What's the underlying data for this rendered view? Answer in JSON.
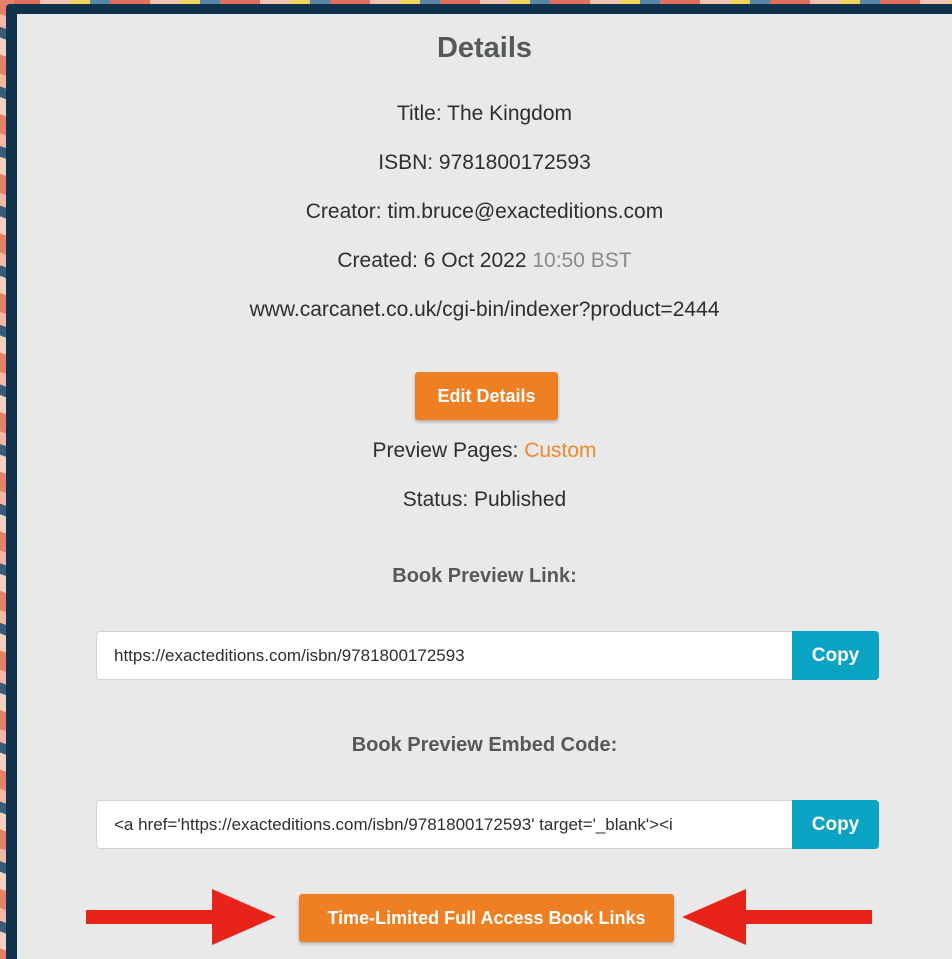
{
  "details": {
    "heading": "Details",
    "title": "Title: The Kingdom",
    "isbn": "ISBN: 9781800172593",
    "creator": "Creator: tim.bruce@exacteditions.com",
    "created_label": "Created: 6 Oct 2022",
    "created_time": "10:50 BST",
    "product_url": "www.carcanet.co.uk/cgi-bin/indexer?product=2444",
    "edit_button": "Edit Details",
    "preview_pages_label": "Preview Pages:",
    "preview_pages_value": "Custom",
    "status": "Status: Published"
  },
  "preview_link": {
    "label": "Book Preview Link:",
    "value": "https://exacteditions.com/isbn/9781800172593",
    "copy_label": "Copy"
  },
  "embed_code": {
    "label": "Book Preview Embed Code:",
    "value": "<a href='https://exacteditions.com/isbn/9781800172593' target='_blank'><i",
    "copy_label": "Copy"
  },
  "time_limited_button": "Time-Limited Full Access Book Links",
  "colors": {
    "accent_orange": "#ee7f22",
    "copy_blue": "#0aa3c4",
    "arrow_red": "#e8231a",
    "frame_navy": "#10324c"
  }
}
